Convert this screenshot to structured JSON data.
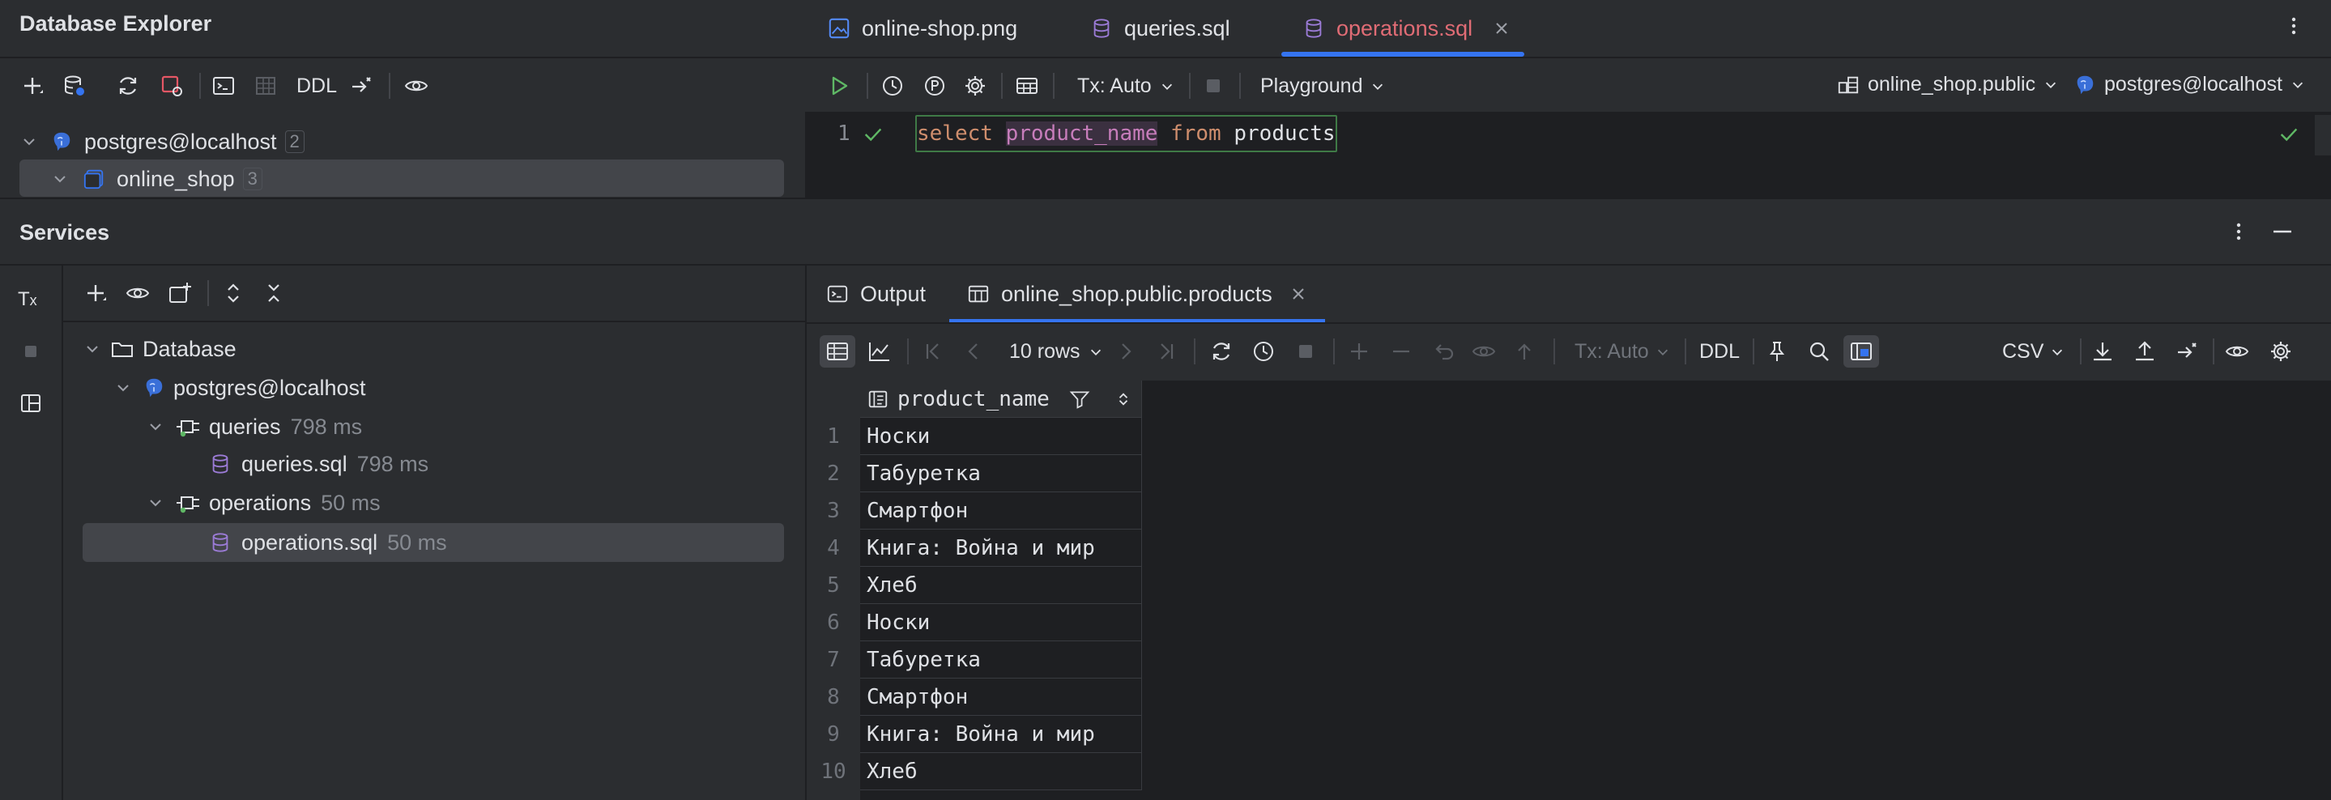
{
  "db_explorer": {
    "title": "Database Explorer",
    "toolbar": {
      "ddl_label": "DDL"
    },
    "tree": [
      {
        "label": "postgres@localhost",
        "count": "2"
      },
      {
        "label": "online_shop",
        "count": "3"
      }
    ]
  },
  "editor": {
    "tabs": [
      {
        "label": "online-shop.png"
      },
      {
        "label": "queries.sql"
      },
      {
        "label": "operations.sql"
      }
    ],
    "toolbar": {
      "tx_label": "Tx: Auto",
      "playground_label": "Playground",
      "schema_label": "online_shop.public",
      "datasource_label": "postgres@localhost"
    },
    "lines": [
      {
        "number": "1",
        "kw1": "select",
        "col": "product_name",
        "kw2": "from",
        "table": "products"
      }
    ]
  },
  "services": {
    "title": "Services",
    "tree": {
      "database": "Database",
      "host": "postgres@localhost",
      "queries": {
        "label": "queries",
        "time": "798 ms"
      },
      "queries_file": {
        "label": "queries.sql",
        "time": "798 ms"
      },
      "operations": {
        "label": "operations",
        "time": "50 ms"
      },
      "operations_file": {
        "label": "operations.sql",
        "time": "50 ms"
      }
    },
    "result_tabs": [
      {
        "label": "Output"
      },
      {
        "label": "online_shop.public.products"
      }
    ],
    "result_toolbar": {
      "rows_label": "10 rows",
      "tx_label": "Tx: Auto",
      "ddl_label": "DDL",
      "csv_label": "CSV"
    },
    "grid": {
      "column": "product_name",
      "rows": [
        {
          "n": "1",
          "value": "Носки"
        },
        {
          "n": "2",
          "value": "Табуретка"
        },
        {
          "n": "3",
          "value": "Смартфон"
        },
        {
          "n": "4",
          "value": "Книга: Война и мир"
        },
        {
          "n": "5",
          "value": "Хлеб"
        },
        {
          "n": "6",
          "value": "Носки"
        },
        {
          "n": "7",
          "value": "Табуретка"
        },
        {
          "n": "8",
          "value": "Смартфон"
        },
        {
          "n": "9",
          "value": "Книга: Война и мир"
        },
        {
          "n": "10",
          "value": "Хлеб"
        }
      ]
    }
  },
  "colors": {
    "accent": "#3574f0",
    "active_tab_text": "#e06c75",
    "run_green": "#5fb865",
    "keyword": "#cf8e6d",
    "column_highlight": "#c77dbb",
    "sql_file_icon": "#9b7bd6"
  }
}
